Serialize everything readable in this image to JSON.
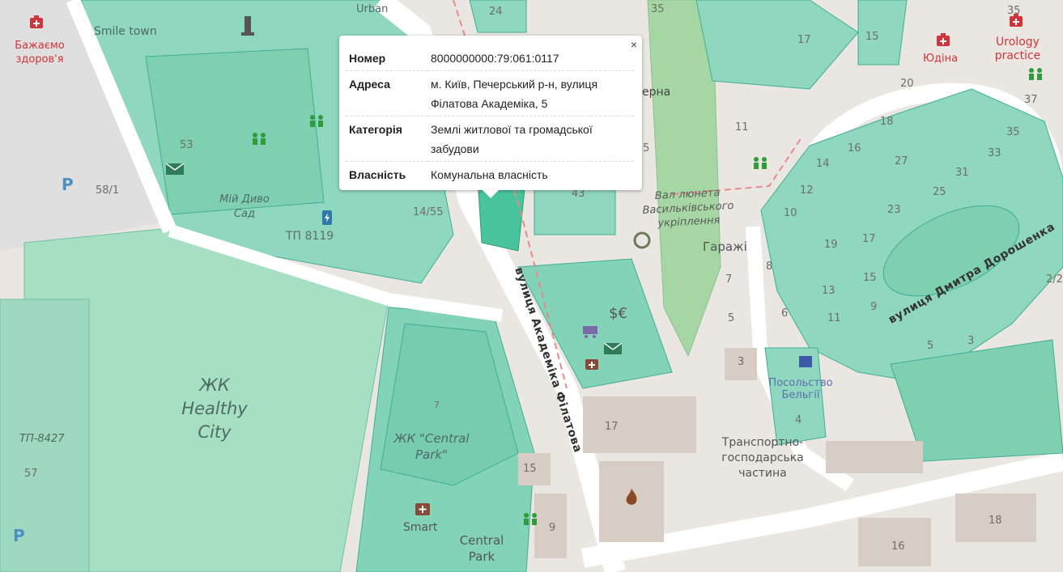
{
  "colors": {
    "parcel": "#74d3b8",
    "parcel_border": "#3fae92",
    "background": "#eae6e1",
    "road": "#ffffff",
    "poi_red": "#d1343a"
  },
  "popup": {
    "close_glyph": "×",
    "rows": [
      {
        "key": "Номер",
        "value": "8000000000:79:061:0117"
      },
      {
        "key": "Адреса",
        "value": "м. Київ, Печерський р-н, вулиця Філатова Академіка, 5"
      },
      {
        "key": "Категорія",
        "value": "Землі житлової та громадської забудови"
      },
      {
        "key": "Власність",
        "value": "Комунальна власність"
      }
    ]
  },
  "labels": {
    "pharmacy_1": "Бажаємо здоров'я",
    "smile_town": "Smile town",
    "urban": "Urban",
    "healthy_city": "ЖК Healthy City",
    "central_park": "ЖК \"Central Park\"",
    "miy_dyvo_sad": "Мій Диво Сад",
    "tp_8119": "ТП 8119",
    "tp_8427": "ТП-8427",
    "street_filatova": "вулиця Академіка Філатова",
    "street_doroshenka": "вулиця Дмитра Дорошенка",
    "val_liuneta": "Вал люнета Васильківського укріплення",
    "garazhi": "Гаражі",
    "transport": "Транспортно-господарська частина",
    "posolstvo": "Посольство Бельгії",
    "udina": "Юдіна",
    "urology": "Urology practice",
    "smart": "Smart",
    "central_park_2": "Central Park",
    "ferna": "ерна"
  },
  "numbers": {
    "n53": "53",
    "n58_1": "58/1",
    "n14_55": "14/55",
    "n57": "57",
    "n7": "7",
    "n15": "15",
    "n9": "9",
    "n17": "17",
    "n3": "3",
    "n5": "5",
    "n7b": "7",
    "n43": "43",
    "n11": "11",
    "n35": "35",
    "n17b": "17",
    "n15b": "15",
    "n20": "20",
    "n18": "18",
    "n16": "16",
    "n14": "14",
    "n12": "12",
    "n10": "10",
    "n8": "8",
    "n6": "6",
    "n27": "27",
    "n23": "23",
    "n25": "25",
    "n31": "31",
    "n33": "33",
    "n35b": "35",
    "n37": "37",
    "n19": "19",
    "n17c": "17",
    "n13": "13",
    "n11b": "11",
    "n9b": "9",
    "n15c": "15",
    "n5b": "5",
    "n3b": "3",
    "n4": "4",
    "n18b": "18",
    "n16b": "16",
    "n2_2": "2/2",
    "n24": "24",
    "n5c": "5",
    "n35c": "35"
  },
  "icons": [
    "pharmacy-icon",
    "post-office-icon",
    "playground-icon",
    "ev-charging-icon",
    "parking-icon",
    "recycling-icon",
    "shop-icon",
    "currency-exchange-icon",
    "fire-station-icon",
    "bus-stop-icon",
    "embassy-icon",
    "monument-icon",
    "tree-icon"
  ]
}
